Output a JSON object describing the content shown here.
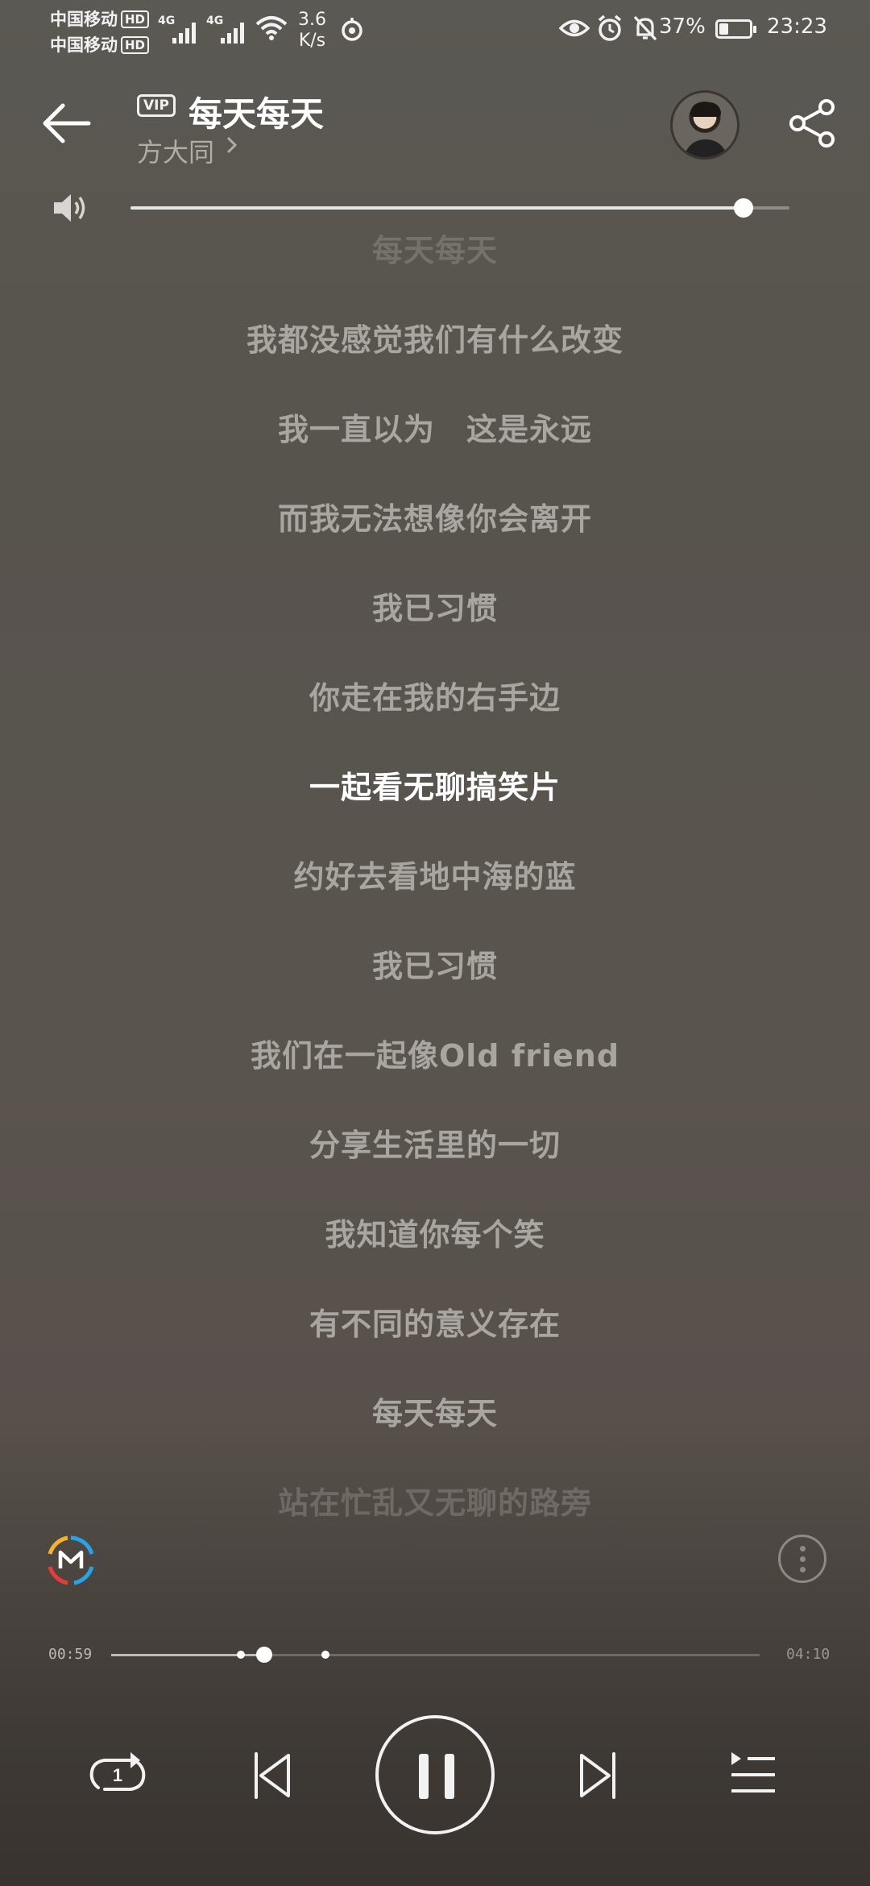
{
  "status_bar": {
    "carrier1": "中国移动",
    "carrier2": "中国移动",
    "hd_badge": "HD",
    "net_type1": "4G",
    "net_type2": "4G",
    "net_speed_value": "3.6",
    "net_speed_unit": "K/s",
    "battery_percent": "37%",
    "battery_level": 0.37,
    "time": "23:23",
    "icons": [
      "signal-icon",
      "wifi-icon",
      "data-saver-icon",
      "eye-icon",
      "alarm-icon",
      "mute-notifications-icon",
      "battery-icon"
    ]
  },
  "header": {
    "vip_label": "VIP",
    "song_title": "每天每天",
    "artist": "方大同",
    "icons": [
      "back-arrow-icon",
      "chevron-right-icon",
      "share-icon"
    ]
  },
  "volume": {
    "level": 0.93,
    "icon": "speaker-icon"
  },
  "lyrics": {
    "lines": [
      "每天每天",
      "我都没感觉我们有什么改变",
      "我一直以为　这是永远",
      "而我无法想像你会离开",
      "我已习惯",
      "你走在我的右手边",
      "一起看无聊搞笑片",
      "约好去看地中海的蓝",
      "我已习惯",
      "我们在一起像Old friend",
      "分享生活里的一切",
      "我知道你每个笑",
      "有不同的意义存在",
      "每天每天",
      "站在忙乱又无聊的路旁"
    ],
    "current_index": 6
  },
  "playback": {
    "elapsed": "00:59",
    "total": "04:10",
    "progress": 0.236,
    "buffered": 0.33,
    "marker": 0.2
  },
  "controls": {
    "repeat_badge": "1",
    "icons": [
      "repeat-one-icon",
      "previous-track-icon",
      "pause-icon",
      "next-track-icon",
      "playlist-icon",
      "m-logo-icon",
      "more-options-icon"
    ]
  },
  "colors": {
    "accent_red": "#e63b3b",
    "accent_blue": "#2aa2e8",
    "accent_yellow": "#f2b233",
    "text_primary": "#ffffff",
    "text_dim": "#a9a6a1"
  }
}
